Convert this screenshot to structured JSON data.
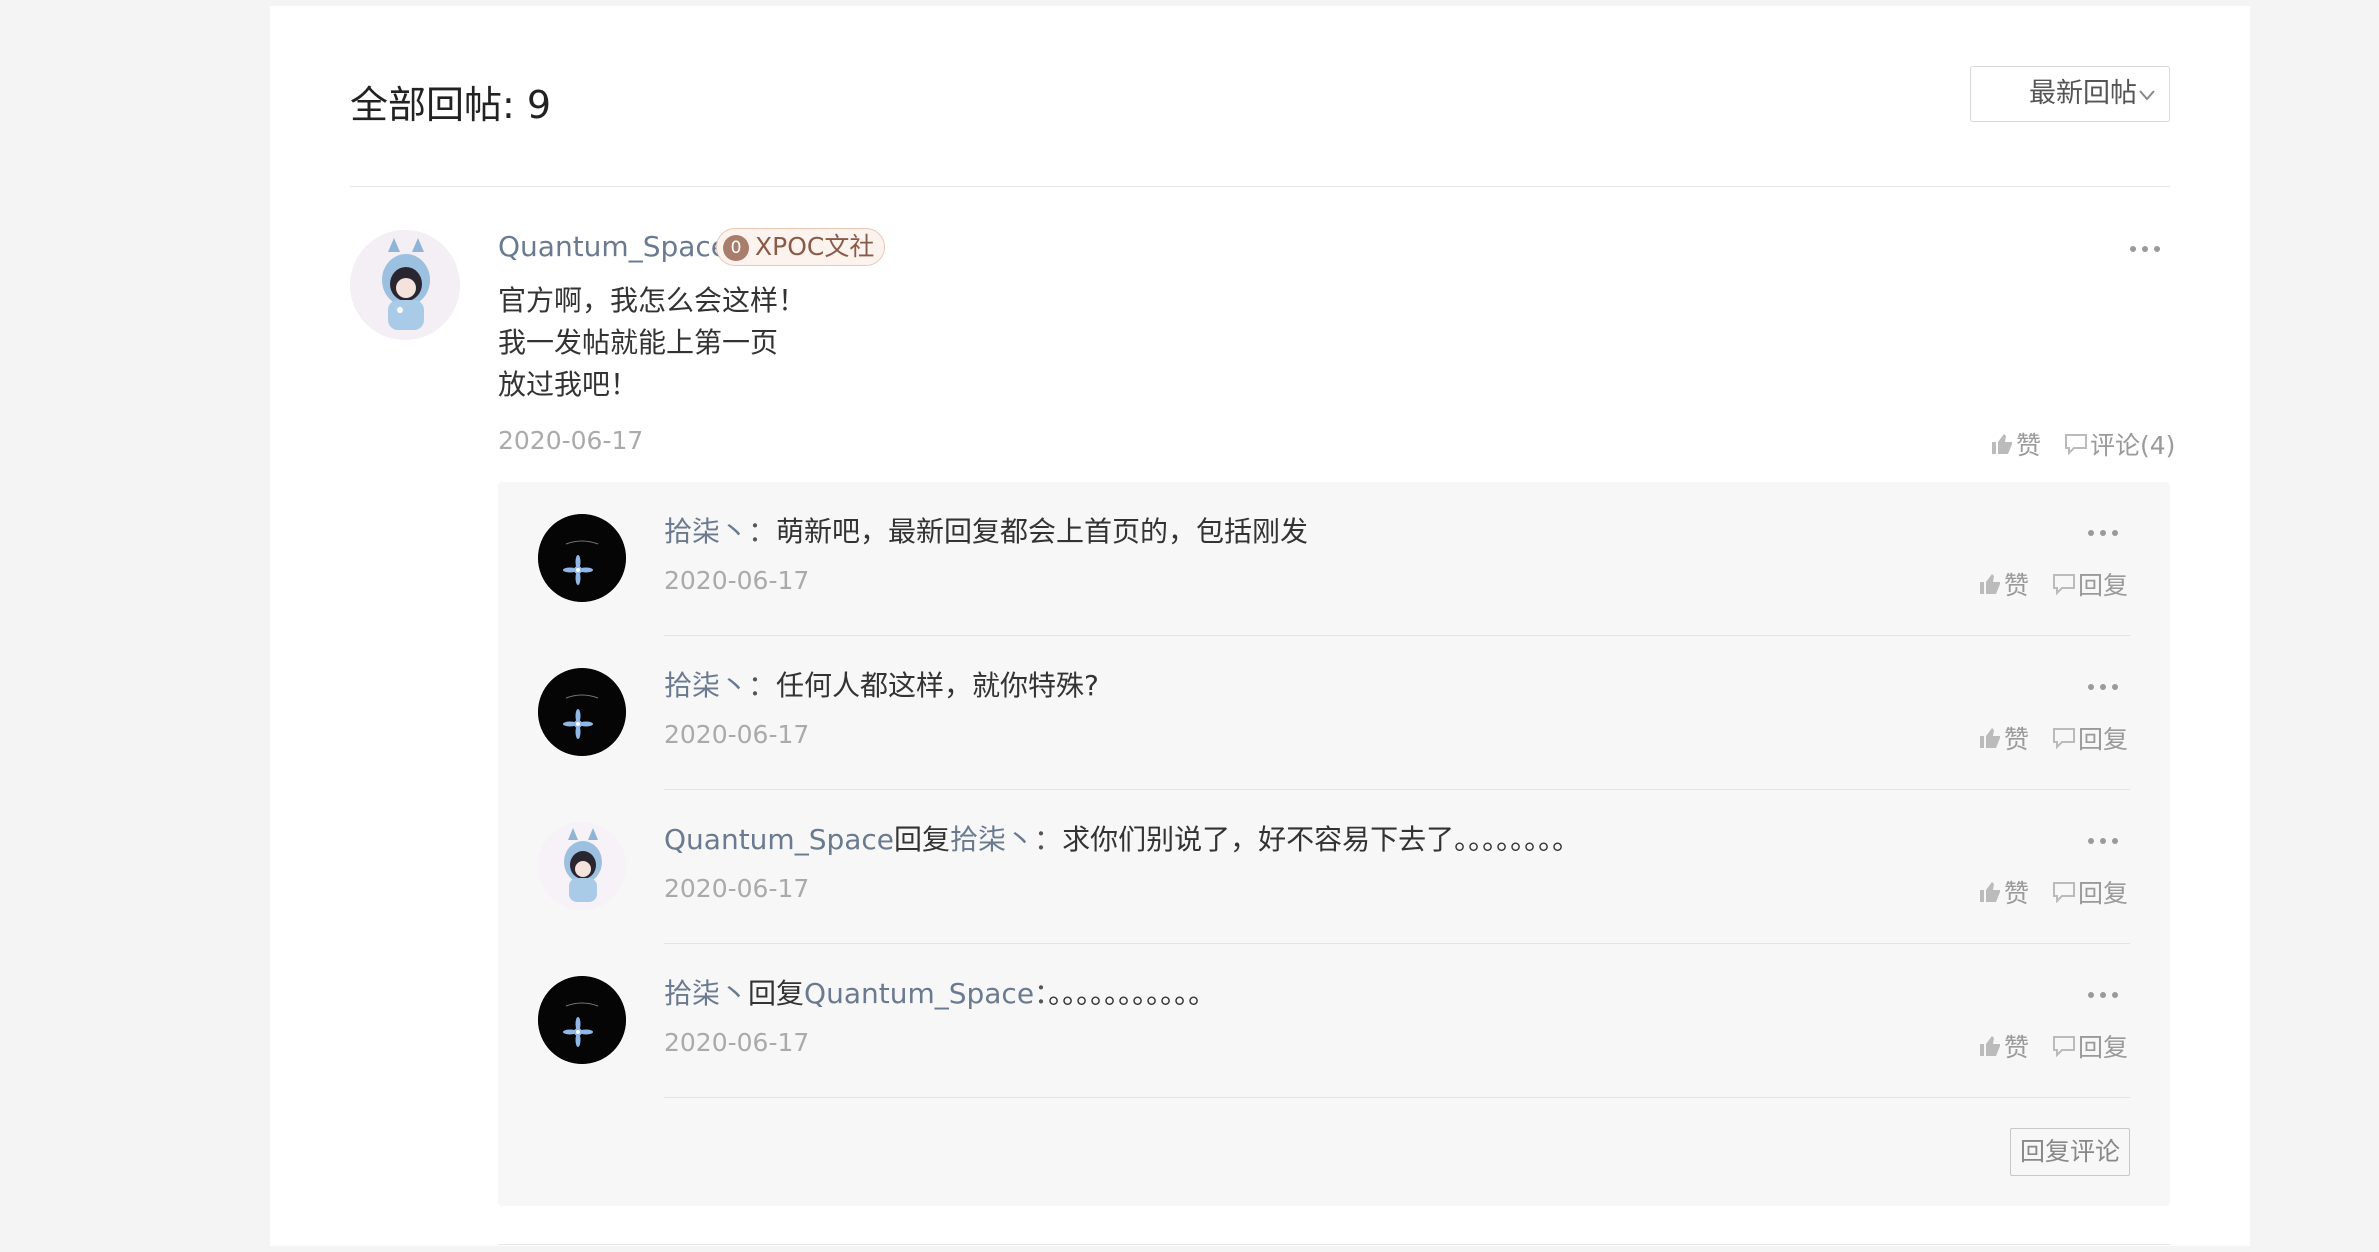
{
  "header": {
    "title": "全部回帖: 9",
    "sort_label": "最新回帖"
  },
  "post": {
    "author": "Quantum_Space",
    "badge_level": "0",
    "badge_name": "XPOC文社",
    "lines": [
      "官方啊，我怎么会这样！",
      "我一发帖就能上第一页",
      "放过我吧！"
    ],
    "date": "2020-06-17",
    "like_label": "赞",
    "comment_label": "评论(4)"
  },
  "comments": [
    {
      "nick": "拾柒丶",
      "reply_word": "",
      "target": "",
      "sep": "：",
      "text": "萌新吧，最新回复都会上首页的，包括刚发",
      "date": "2020-06-17",
      "like_label": "赞",
      "reply_label": "回复"
    },
    {
      "nick": "拾柒丶",
      "reply_word": "",
      "target": "",
      "sep": "：",
      "text": "任何人都这样，就你特殊?",
      "date": "2020-06-17",
      "like_label": "赞",
      "reply_label": "回复"
    },
    {
      "nick": "Quantum_Space",
      "reply_word": "回复",
      "target": "拾柒丶",
      "sep": "：",
      "text": "求你们别说了，好不容易下去了。。。。。。。。",
      "date": "2020-06-17",
      "like_label": "赞",
      "reply_label": "回复"
    },
    {
      "nick": "拾柒丶",
      "reply_word": "回复",
      "target": "Quantum_Space",
      "sep": "：",
      "text": "。。。。。。。。。。。",
      "date": "2020-06-17",
      "like_label": "赞",
      "reply_label": "回复"
    }
  ],
  "reply_comment_label": "回复评论",
  "icons": {
    "like": "thumb-up-icon",
    "comment": "speech-bubble-icon",
    "more": "ellipsis-icon",
    "sort": "chevron-down-icon"
  }
}
